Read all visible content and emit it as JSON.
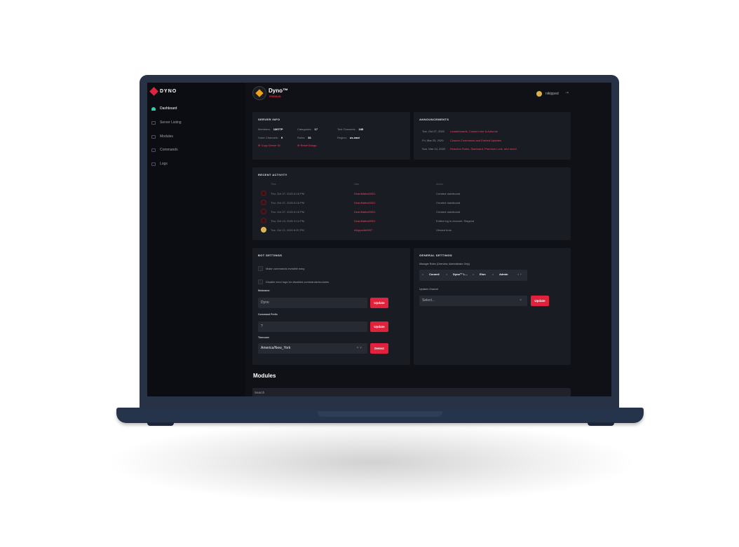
{
  "brand": {
    "name": "DYNO",
    "accent": "#e0223c"
  },
  "sidebar": {
    "items": [
      {
        "label": "Dashboard",
        "icon": "dashboard-icon",
        "active": true
      },
      {
        "label": "Server Listing",
        "icon": "listing-icon",
        "active": false
      },
      {
        "label": "Modules",
        "icon": "modules-icon",
        "active": false
      },
      {
        "label": "Commands",
        "icon": "commands-icon",
        "active": false
      },
      {
        "label": "Logs",
        "icon": "logs-icon",
        "active": false
      }
    ]
  },
  "header": {
    "server_name": "Dyno™",
    "badge": "PREMIUM",
    "username": "nikipped",
    "logout_icon": "logout-icon"
  },
  "server_info": {
    "title": "SERVER INFO",
    "members_label": "Members:",
    "members_value": "13077P",
    "categories_label": "Categories:",
    "categories_value": "17",
    "text_channels_label": "Text Channels:",
    "text_channels_value": "185",
    "voice_channels_label": "Voice Channels:",
    "voice_channels_value": "9",
    "roles_label": "Roles:",
    "roles_value": "81",
    "region_label": "Region:",
    "region_value": "us-east",
    "copy_link": "Copy Server ID",
    "reset_link": "Reset Dosgs"
  },
  "announcements": {
    "title": "ANNOUNCEMENTS",
    "items": [
      {
        "date": "Tue, Oct 27, 2020",
        "text": "Leaderboards, Custom role & Autorole"
      },
      {
        "date": "Fri, Mar 25, 2020",
        "text": "Custom Commands and Embed Updates"
      },
      {
        "date": "Sun, Mar 24, 2020",
        "text": "Reaction Roles, Starboard, Premium Lock, and more!"
      }
    ]
  },
  "recent_activity": {
    "title": "RECENT ACTIVITY",
    "columns": [
      "Time",
      "User",
      "Action"
    ],
    "rows": [
      {
        "time": "Thu, Oct 27, 2020 8:16 PM",
        "user": "DeanMatin#0001",
        "action": "Created dashboard"
      },
      {
        "time": "Thu, Oct 27, 2020 8:16 PM",
        "user": "DeanMatin#0001",
        "action": "Created dashboard"
      },
      {
        "time": "Thu, Oct 27, 2020 8:16 PM",
        "user": "DeanMatin#0001",
        "action": "Created dashboard"
      },
      {
        "time": "Thu, Oct 13, 2020 3:14 PM",
        "user": "DeanMatin#0001",
        "action": "Edited log in channel: Stagend"
      },
      {
        "time": "Tue, Oct 12, 2020 8:20 PM",
        "user": "nikipped#4557",
        "action": "Viewed bots"
      }
    ]
  },
  "bot_settings": {
    "title": "BOT SETTINGS",
    "check1": "Make commands invisible easy",
    "check2": "Disable error logs for disabled commands/modules",
    "nickname_label": "Nickname",
    "nickname_value": "Dyno",
    "prefix_label": "Command Prefix",
    "prefix_value": "?",
    "timezone_label": "Timezone",
    "timezone_value": "America/New_York",
    "update": "Update",
    "detect": "Detect",
    "clear": "× ˅"
  },
  "general_settings": {
    "title": "GENERAL SETTINGS",
    "manager_label": "Manager Roles (Overview, Administrator Only)",
    "tags": [
      "Council",
      "Dyno™ L...",
      "Elon",
      "Admin"
    ],
    "channel_label": "Updates Channel",
    "channel_placeholder": "Select...",
    "update": "Update"
  },
  "modules": {
    "title": "Modules",
    "search_placeholder": "Search"
  }
}
